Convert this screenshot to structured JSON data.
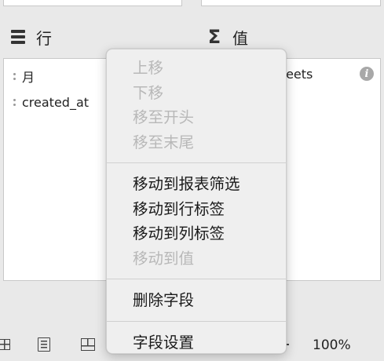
{
  "rows_section": {
    "title": "行",
    "fields": [
      "月",
      "created_at"
    ]
  },
  "values_section": {
    "title": "值",
    "field_text": "weets",
    "info_icon_glyph": "i"
  },
  "bottom_bar": {
    "zoom": "100%"
  },
  "context_menu": {
    "group1": [
      {
        "label": "上移",
        "enabled": false
      },
      {
        "label": "下移",
        "enabled": false
      },
      {
        "label": "移至开头",
        "enabled": false
      },
      {
        "label": "移至末尾",
        "enabled": false
      }
    ],
    "group2": [
      {
        "label": "移动到报表筛选",
        "enabled": true
      },
      {
        "label": "移动到行标签",
        "enabled": true
      },
      {
        "label": "移动到列标签",
        "enabled": true
      },
      {
        "label": "移动到值",
        "enabled": false
      }
    ],
    "group3": [
      {
        "label": "删除字段",
        "enabled": true
      }
    ],
    "group4": [
      {
        "label": "字段设置",
        "enabled": true
      }
    ]
  },
  "colors": {
    "background": "#e9e9e9",
    "panel": "#ffffff",
    "menu_bg": "#efefef",
    "disabled_text": "#b8b8b8"
  }
}
